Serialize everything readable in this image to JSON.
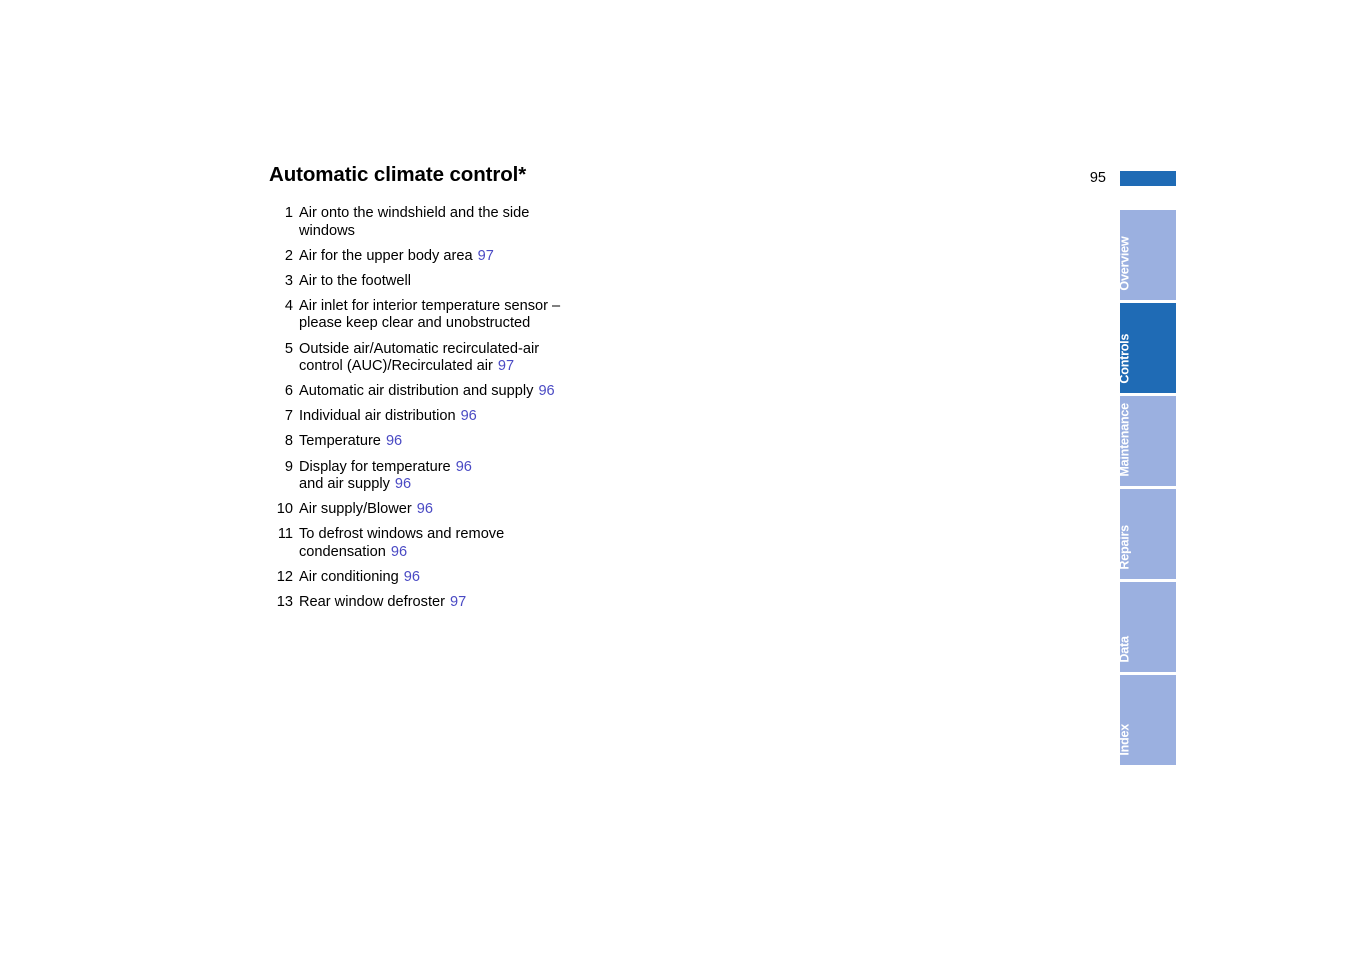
{
  "document": {
    "title": "Automatic climate control*",
    "page_number": "95",
    "accent_color": "#1F6BB5",
    "page_ref_color": "#4A4AC4",
    "tab_inactive_color": "#9BB0E0"
  },
  "legend": {
    "items": [
      {
        "num": "1",
        "text": "Air onto the windshield and the side windows",
        "ref": ""
      },
      {
        "num": "2",
        "text": "Air for the upper body area",
        "ref": "97"
      },
      {
        "num": "3",
        "text": "Air to the footwell",
        "ref": ""
      },
      {
        "num": "4",
        "text": "Air inlet for interior temperature sensor – please keep clear and unobstructed",
        "ref": ""
      },
      {
        "num": "5",
        "text": "Outside air/Automatic recirculated-air control (AUC)/Recirculated air",
        "ref": "97"
      },
      {
        "num": "6",
        "text": "Automatic air distribution and supply",
        "ref": "96"
      },
      {
        "num": "7",
        "text": "Individual air distribution",
        "ref": "96"
      },
      {
        "num": "8",
        "text": "Temperature",
        "ref": "96"
      },
      {
        "num": "9",
        "text": "Display for temperature",
        "ref": "96",
        "text2": "and air supply",
        "ref2": "96"
      },
      {
        "num": "10",
        "text": "Air supply/Blower",
        "ref": "96"
      },
      {
        "num": "11",
        "text": "To defrost windows and remove condensation",
        "ref": "96"
      },
      {
        "num": "12",
        "text": "Air conditioning",
        "ref": "96"
      },
      {
        "num": "13",
        "text": "Rear window defroster",
        "ref": "97"
      }
    ]
  },
  "side_tabs": {
    "items": [
      {
        "label": "Overview",
        "active": false
      },
      {
        "label": "Controls",
        "active": true
      },
      {
        "label": "Maintenance",
        "active": false
      },
      {
        "label": "Repairs",
        "active": false
      },
      {
        "label": "Data",
        "active": false
      },
      {
        "label": "Index",
        "active": false
      }
    ]
  }
}
